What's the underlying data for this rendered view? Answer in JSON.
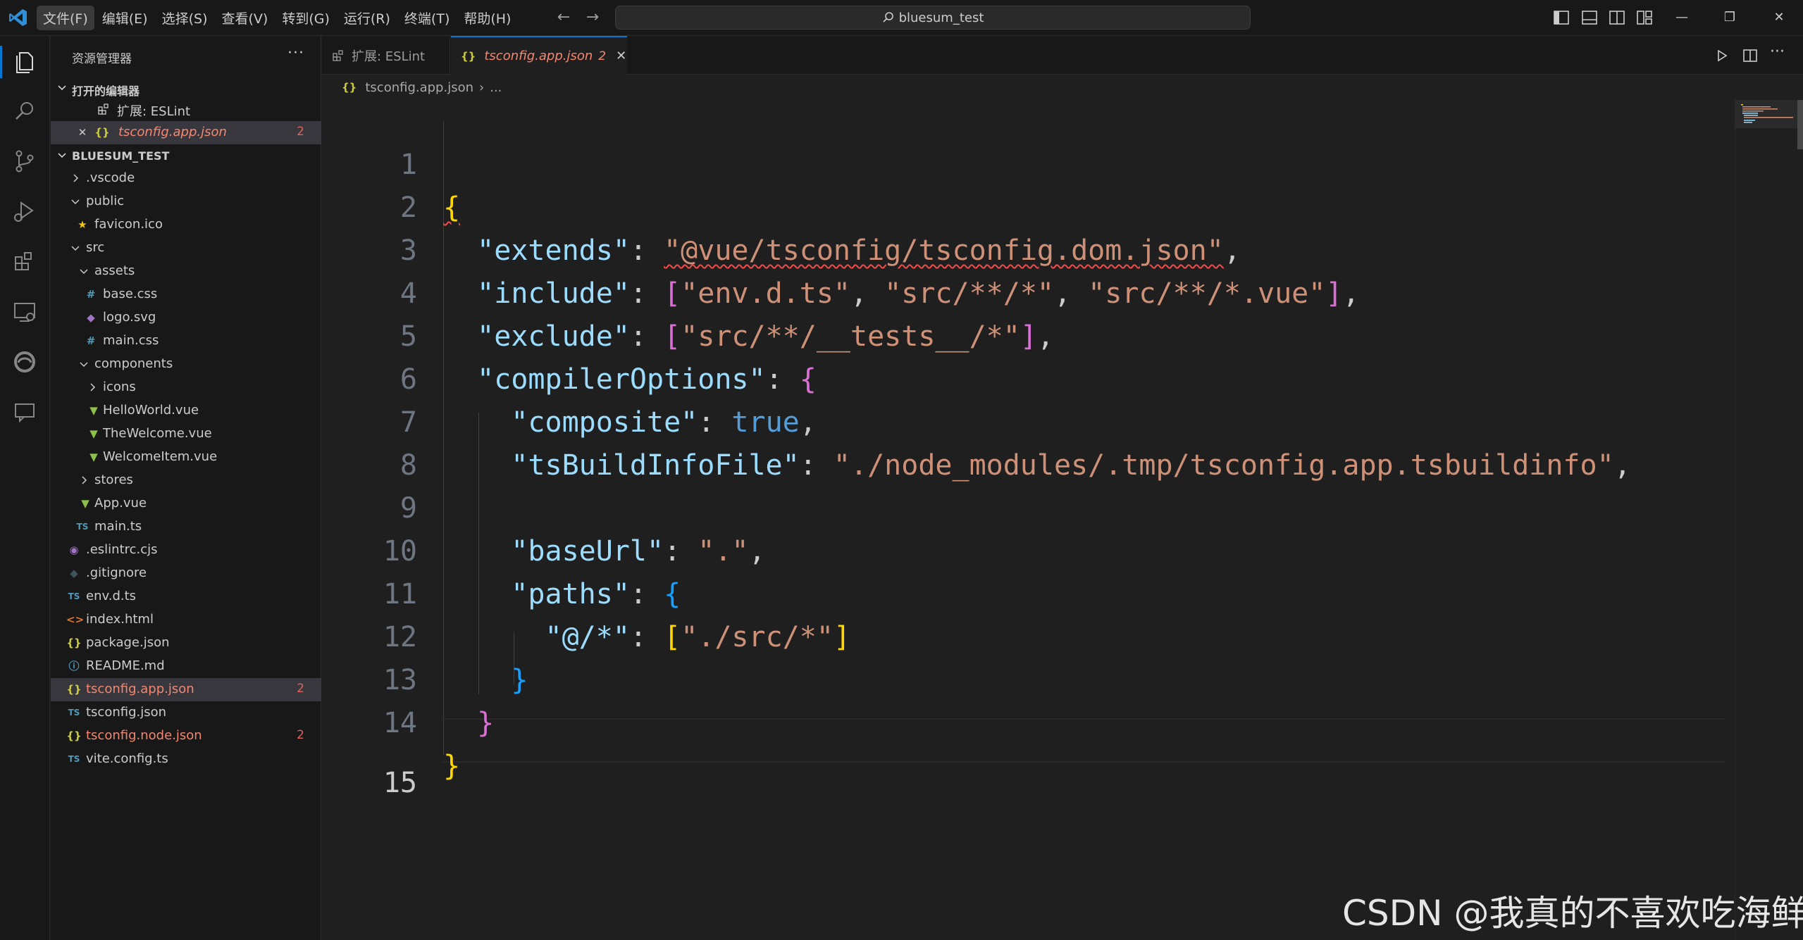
{
  "window": {
    "menu": [
      "文件(F)",
      "编辑(E)",
      "选择(S)",
      "查看(V)",
      "转到(G)",
      "运行(R)",
      "终端(T)",
      "帮助(H)"
    ],
    "search_label": "bluesum_test"
  },
  "sidebar": {
    "title": "资源管理器",
    "more": "···",
    "open_editors_title": "打开的编辑器",
    "open_editors": [
      {
        "label": "扩展: ESLint"
      },
      {
        "label": "tsconfig.app.json",
        "badge": "2"
      }
    ],
    "project_title": "BLUESUM_TEST",
    "tree": [
      {
        "label": ".vscode"
      },
      {
        "label": "public"
      },
      {
        "label": "favicon.ico"
      },
      {
        "label": "src"
      },
      {
        "label": "assets"
      },
      {
        "label": "base.css"
      },
      {
        "label": "logo.svg"
      },
      {
        "label": "main.css"
      },
      {
        "label": "components"
      },
      {
        "label": "icons"
      },
      {
        "label": "HelloWorld.vue"
      },
      {
        "label": "TheWelcome.vue"
      },
      {
        "label": "WelcomeItem.vue"
      },
      {
        "label": "stores"
      },
      {
        "label": "App.vue"
      },
      {
        "label": "main.ts"
      },
      {
        "label": ".eslintrc.cjs"
      },
      {
        "label": ".gitignore"
      },
      {
        "label": "env.d.ts"
      },
      {
        "label": "index.html"
      },
      {
        "label": "package.json"
      },
      {
        "label": "README.md"
      },
      {
        "label": "tsconfig.app.json",
        "badge": "2"
      },
      {
        "label": "tsconfig.json"
      },
      {
        "label": "tsconfig.node.json",
        "badge": "2"
      },
      {
        "label": "vite.config.ts"
      }
    ]
  },
  "editor": {
    "tabs": [
      {
        "label": "扩展: ESLint"
      },
      {
        "label": "tsconfig.app.json",
        "badge": "2"
      }
    ],
    "breadcrumb": {
      "file": "tsconfig.app.json",
      "more": "..."
    },
    "line_numbers": [
      "1",
      "2",
      "3",
      "4",
      "5",
      "6",
      "7",
      "8",
      "9",
      "10",
      "11",
      "12",
      "13",
      "14",
      "15"
    ],
    "code": {
      "extends_key": "\"extends\"",
      "extends_val": "\"@vue/tsconfig/tsconfig.dom.json\"",
      "include_key": "\"include\"",
      "include_v1": "\"env.d.ts\"",
      "include_v2": "\"src/**/*\"",
      "include_v3": "\"src/**/*.vue\"",
      "exclude_key": "\"exclude\"",
      "exclude_v1": "\"src/**/__tests__/*\"",
      "compiler_key": "\"compilerOptions\"",
      "composite_key": "\"composite\"",
      "composite_val": "true",
      "tsbuild_key": "\"tsBuildInfoFile\"",
      "tsbuild_val": "\"./node_modules/.tmp/tsconfig.app.tsbuildinfo\"",
      "baseurl_key": "\"baseUrl\"",
      "baseurl_val": "\".\"",
      "paths_key": "\"paths\"",
      "alias_key": "\"@/*\"",
      "alias_val": "\"./src/*\""
    }
  },
  "watermark": "CSDN @我真的不喜欢吃海鲜"
}
